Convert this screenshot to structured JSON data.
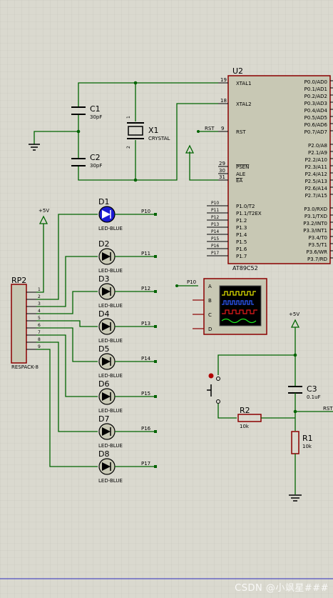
{
  "mcu": {
    "ref": "U2",
    "part": "AT89C52",
    "left_pins": [
      {
        "num": "19",
        "name": "XTAL1"
      },
      {
        "num": "18",
        "name": "XTAL2"
      },
      {
        "num": "9",
        "name": "RST"
      },
      {
        "num": "29",
        "name": "PSEN"
      },
      {
        "num": "30",
        "name": "ALE"
      },
      {
        "num": "31",
        "name": "EA"
      }
    ],
    "right_pins": [
      "P0.0/AD0",
      "P0.1/AD1",
      "P0.2/AD2",
      "P0.3/AD3",
      "P0.4/AD4",
      "P0.5/AD5",
      "P0.6/AD6",
      "P0.7/AD7",
      "P2.0/A8",
      "P2.1/A9",
      "P2.2/A10",
      "P2.3/A11",
      "P2.4/A12",
      "P2.5/A13",
      "P2.6/A14",
      "P2.7/A15",
      "P3.0/RXD",
      "P3.1/TXD",
      "P3.2/INT0",
      "P3.3/INT1",
      "P3.4/T0",
      "P3.5/T1",
      "P3.6/WR",
      "P3.7/RD"
    ],
    "p1_pins": [
      "P1.0/T2",
      "P1.1/T2EX",
      "P1.2",
      "P1.3",
      "P1.4",
      "P1.5",
      "P1.6",
      "P1.7"
    ],
    "p1_nets": [
      "P10",
      "P11",
      "P12",
      "P13",
      "P14",
      "P15",
      "P16",
      "P17"
    ],
    "rst_net": "RST"
  },
  "c1": {
    "ref": "C1",
    "value": "30pF"
  },
  "c2": {
    "ref": "C2",
    "value": "30pF"
  },
  "crystal": {
    "ref": "X1",
    "value": "CRYSTAL",
    "pin1": "1",
    "pin2": "2"
  },
  "leds": [
    {
      "ref": "D1",
      "value": "LED-BLUE",
      "net": "P10"
    },
    {
      "ref": "D2",
      "value": "LED-BLUE",
      "net": "P11"
    },
    {
      "ref": "D3",
      "value": "LED-BLUE",
      "net": "P12"
    },
    {
      "ref": "D4",
      "value": "LED-BLUE",
      "net": "P13"
    },
    {
      "ref": "D5",
      "value": "LED-BLUE",
      "net": "P14"
    },
    {
      "ref": "D6",
      "value": "LED-BLUE",
      "net": "P15"
    },
    {
      "ref": "D7",
      "value": "LED-BLUE",
      "net": "P16"
    },
    {
      "ref": "D8",
      "value": "LED-BLUE",
      "net": "P17"
    }
  ],
  "respack": {
    "ref": "RP2",
    "value": "RESPACK-8",
    "pins": [
      "1",
      "2",
      "3",
      "4",
      "5",
      "6",
      "7",
      "8",
      "9"
    ]
  },
  "vcc": {
    "left": "+5V",
    "right": "+5V"
  },
  "scope": {
    "channels": [
      "A",
      "B",
      "C",
      "D"
    ],
    "net": "P10"
  },
  "c3": {
    "ref": "C3",
    "value": "0.1uF"
  },
  "r2": {
    "ref": "R2",
    "value": "10k"
  },
  "r1": {
    "ref": "R1",
    "value": "10k"
  },
  "reset_net": "RST",
  "watermark": "CSDN @小飒星###",
  "colors": {
    "background": "#dad9cf",
    "wire": "#006400",
    "body": "#c8c8b4",
    "outline": "#8b0000",
    "led_on": "#1c1cd4"
  }
}
